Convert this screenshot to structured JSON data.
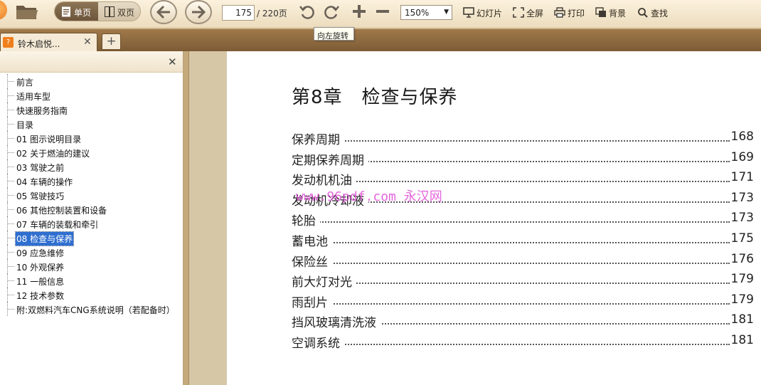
{
  "toolbar": {
    "view_single": "单页",
    "view_double": "双页",
    "page_current": "175",
    "page_total": "/ 220页",
    "zoom": "150%",
    "slideshow": "幻灯片",
    "fullscreen": "全屏",
    "print": "打印",
    "background": "背景",
    "find": "查找"
  },
  "tooltip": "向左旋转",
  "tabs": [
    {
      "title": "铃木启悦..."
    }
  ],
  "sidebar": {
    "items": [
      {
        "label": "前言"
      },
      {
        "label": "适用车型"
      },
      {
        "label": "快速服务指南"
      },
      {
        "label": "目录"
      },
      {
        "label": "01 图示说明目录"
      },
      {
        "label": "02 关于燃油的建议"
      },
      {
        "label": "03 驾驶之前"
      },
      {
        "label": "04 车辆的操作"
      },
      {
        "label": "05 驾驶技巧"
      },
      {
        "label": "06 其他控制装置和设备"
      },
      {
        "label": "07 车辆的装载和牵引"
      },
      {
        "label": "08 检查与保养"
      },
      {
        "label": "09 应急维修"
      },
      {
        "label": "10 外观保养"
      },
      {
        "label": "11 一般信息"
      },
      {
        "label": "12 技术参数"
      },
      {
        "label": "附:双燃料汽车CNG系统说明（若配备时）"
      }
    ],
    "selected_index": 11
  },
  "document": {
    "chapter_title": "第8章　检查与保养",
    "toc": [
      {
        "title": "保养周期",
        "page": "168"
      },
      {
        "title": "定期保养周期",
        "page": "169"
      },
      {
        "title": "发动机机油",
        "page": "171"
      },
      {
        "title": "发动机冷却液",
        "page": "173"
      },
      {
        "title": "轮胎",
        "page": "173"
      },
      {
        "title": "蓄电池",
        "page": "175"
      },
      {
        "title": "保险丝",
        "page": "176"
      },
      {
        "title": "前大灯对光",
        "page": "179"
      },
      {
        "title": "雨刮片",
        "page": "179"
      },
      {
        "title": "挡风玻璃清洗液",
        "page": "181"
      },
      {
        "title": "空调系统",
        "page": "181"
      }
    ],
    "watermark": "www.96pdf.com 永汉网"
  },
  "colors": {
    "toolbar_bg": "#f3e6cc",
    "tabbar_bg": "#8d6a3f",
    "selection": "#2f6fd0",
    "watermark": "#e04bd6"
  }
}
